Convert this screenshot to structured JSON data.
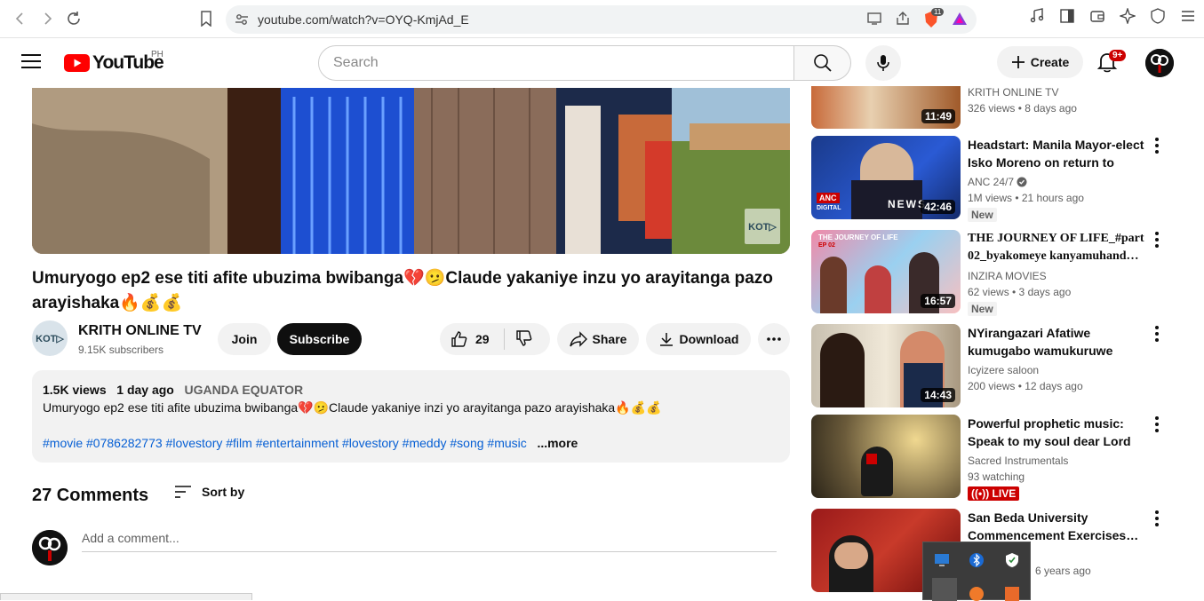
{
  "browser": {
    "url": "youtube.com/watch?v=OYQ-KmjAd_E",
    "shield_badge": "11"
  },
  "header": {
    "logo_text": "YouTube",
    "region": "PH",
    "search_placeholder": "Search",
    "create_label": "Create",
    "notifications_badge": "9+"
  },
  "video": {
    "title": "Umuryogo ep2 ese titi afite ubuzima bwibanga💔🫤Claude yakaniye inzu yo arayitanga pazo arayishaka🔥💰💰",
    "watermark": "KOT▷",
    "channel_avatar_text": "KOT▷",
    "channel_name": "KRITH ONLINE TV",
    "subscribers": "9.15K subscribers",
    "join_label": "Join",
    "subscribe_label": "Subscribe",
    "likes": "29",
    "share_label": "Share",
    "download_label": "Download"
  },
  "description": {
    "views": "1.5K views",
    "age": "1 day ago",
    "location": "UGANDA EQUATOR",
    "text": "Umuryogo ep2 ese titi  afite ubuzima bwibanga💔🫤Claude yakaniye inzi yo arayitanga pazo arayishaka🔥💰💰",
    "hashtags": "#movie #0786282773 #lovestory #film #entertainment #lovestory #meddy #song #music",
    "more_label": "...more"
  },
  "comments": {
    "count": "27 Comments",
    "sort_label": "Sort by",
    "placeholder": "Add a comment..."
  },
  "sidebar": [
    {
      "title": "",
      "channel": "KRITH ONLINE TV",
      "meta": "326 views  •  8 days ago",
      "duration": "11:49",
      "badge": ""
    },
    {
      "title": "Headstart: Manila Mayor-elect Isko Moreno on return to city's…",
      "channel": "ANC 24/7",
      "meta": "1M views  •  21 hours ago",
      "duration": "42:46",
      "badge": "New"
    },
    {
      "title": "THE JOURNEY OF LIFE_#part 02_byakomeye kanyamuhand…",
      "channel": "INZIRA MOVIES",
      "meta": "62 views  •  3 days ago",
      "duration": "16:57",
      "badge": "New"
    },
    {
      "title": "NYirangazari Afatiwe kumugabo wamukuruwe",
      "channel": "Icyizere saloon",
      "meta": "200 views  •  12 days ago",
      "duration": "14:43",
      "badge": ""
    },
    {
      "title": "Powerful prophetic music: Speak to my soul dear Lord",
      "channel": "Sacred Instrumentals",
      "meta": "93 watching",
      "duration": "",
      "badge": "LIVE"
    },
    {
      "title": "San Beda University Commencement Exercises…",
      "channel": "ang",
      "meta": "6 years ago",
      "duration": "",
      "badge": ""
    }
  ],
  "thumb_labels": {
    "anc": "ANC",
    "digital": "DIGITAL",
    "news": "NEWS",
    "journey": "THE JOURNEY OF LIFE",
    "journey_ep": "EP 02"
  }
}
